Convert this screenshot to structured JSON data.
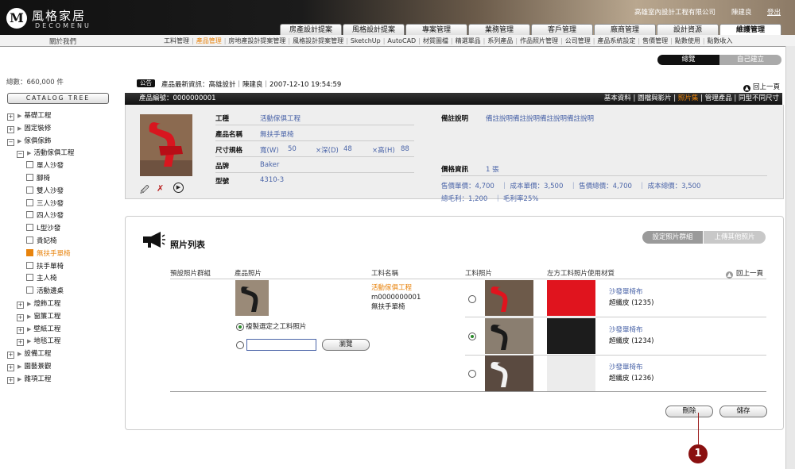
{
  "header": {
    "logo_mark": "M",
    "logo_text": "風格家居",
    "logo_sub": "DECOMENU",
    "company": "高雄室內設計工程有限公司",
    "user": "陳建良",
    "logout": "登出",
    "tabs": [
      "房產設計提案",
      "風格設計提案",
      "專案管理",
      "業務管理",
      "客戶管理",
      "廠商管理",
      "設計資源",
      "維護管理"
    ]
  },
  "subnav": {
    "about": "關於我們",
    "items": [
      "工料管理",
      "產品管理",
      "房地產設計提案管理",
      "風格設計提案管理",
      "SketchUp",
      "AutoCAD",
      "材質圖檔",
      "精選單品",
      "系列產品",
      "作品照片管理",
      "公司管理",
      "產品系統設定",
      "售價管理",
      "點數使用",
      "點數收入"
    ],
    "current": 1
  },
  "toggle": {
    "overview": "總覽",
    "self_built": "自己建立"
  },
  "sidebar": {
    "total": "總數：660,000 件",
    "catalog_btn": "CATALOG TREE",
    "tree": [
      {
        "label": "基礎工程",
        "level": 0,
        "type": "plus"
      },
      {
        "label": "固定裝修",
        "level": 0,
        "type": "plus"
      },
      {
        "label": "傢俱傢飾",
        "level": 0,
        "type": "minus"
      },
      {
        "label": "活動傢俱工程",
        "level": 1,
        "type": "minus"
      },
      {
        "label": "單人沙發",
        "level": 2,
        "type": "box"
      },
      {
        "label": "腳椅",
        "level": 2,
        "type": "box"
      },
      {
        "label": "雙人沙發",
        "level": 2,
        "type": "box"
      },
      {
        "label": "三人沙發",
        "level": 2,
        "type": "box"
      },
      {
        "label": "四人沙發",
        "level": 2,
        "type": "box"
      },
      {
        "label": "L型沙發",
        "level": 2,
        "type": "box"
      },
      {
        "label": "貴妃椅",
        "level": 2,
        "type": "box"
      },
      {
        "label": "無扶手單椅",
        "level": 2,
        "type": "box",
        "selected": true
      },
      {
        "label": "扶手單椅",
        "level": 2,
        "type": "box"
      },
      {
        "label": "主人椅",
        "level": 2,
        "type": "box"
      },
      {
        "label": "活動邊桌",
        "level": 2,
        "type": "box"
      },
      {
        "label": "燈飾工程",
        "level": 1,
        "type": "plus"
      },
      {
        "label": "窗簾工程",
        "level": 1,
        "type": "plus"
      },
      {
        "label": "壁紙工程",
        "level": 1,
        "type": "plus"
      },
      {
        "label": "地毯工程",
        "level": 1,
        "type": "plus"
      },
      {
        "label": "設備工程",
        "level": 0,
        "type": "plus"
      },
      {
        "label": "園藝景觀",
        "level": 0,
        "type": "plus"
      },
      {
        "label": "雜項工程",
        "level": 0,
        "type": "plus"
      }
    ]
  },
  "news": {
    "badge": "公告",
    "text": "產品最新資訊：高雄設計｜陳建良｜2007-12-10  19:54:59",
    "back_top": "回上一頁"
  },
  "product": {
    "code": "產品編號：0000000001",
    "links": [
      "基本資料",
      "圖檔與影片",
      "照片集",
      "管理產品",
      "同型不同尺寸"
    ],
    "current_link": 2,
    "labels": {
      "category": "工種",
      "name": "產品名稱",
      "size": "尺寸規格",
      "brand": "品牌",
      "model": "型號",
      "note": "備註說明",
      "price": "價格資訊"
    },
    "category": "活動傢俱工程",
    "name": "無扶手單椅",
    "size": {
      "w_label": "寬(W)",
      "w": "50",
      "d_label": "×深(D)",
      "d": "48",
      "h_label": "×高(H)",
      "h": "88"
    },
    "brand": "Baker",
    "model": "4310-3",
    "note": "備註說明備註說明備註說明備註說明",
    "price_count": "1 張",
    "price_line1": "售價單價：4,700　｜ 成本單價：3,500　｜ 售價總價：4,700　｜ 成本總價：3,500",
    "price_line2": "總毛利：1,200　｜ 毛利率25%"
  },
  "photo_list": {
    "title": "照片列表",
    "btn_set_group": "設定照片群組",
    "btn_upload": "上傳其他照片",
    "headers": [
      "預設照片群組",
      "產品照片",
      "工料名稱",
      "工料照片",
      "左方工料照片使用材質"
    ],
    "back_top": "回上一頁",
    "item_category": "活動傢俱工程",
    "item_code": "m0000000001",
    "item_name": "無扶手單椅",
    "opt_copy": "複製選定之工料照片",
    "browse": "瀏覽",
    "materials": [
      {
        "name": "沙發單椅布",
        "code": "超纖皮 (1235)",
        "color": "#e0141e",
        "selected": false
      },
      {
        "name": "沙發單椅布",
        "code": "超纖皮 (1234)",
        "color": "#1c1c1c",
        "selected": true
      },
      {
        "name": "沙發單椅布",
        "code": "超纖皮 (1236)",
        "color": "#ececec",
        "selected": false
      }
    ],
    "btn_delete": "刪除",
    "btn_save": "儲存",
    "callout": "1"
  }
}
